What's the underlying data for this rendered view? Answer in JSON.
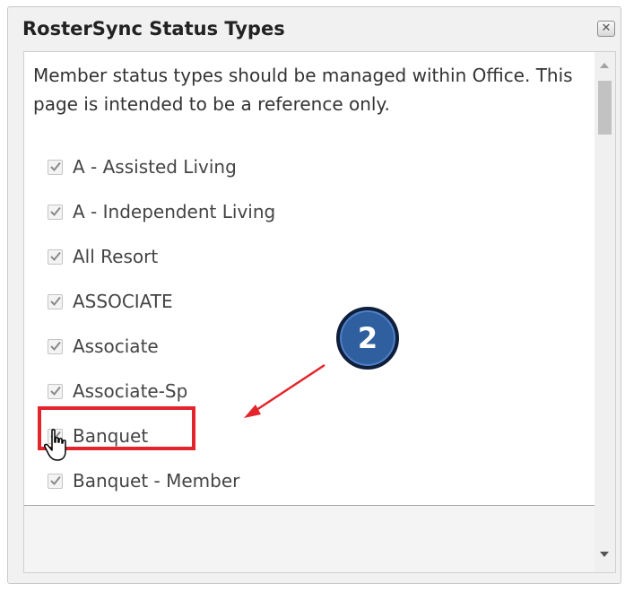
{
  "dialog": {
    "title": "RosterSync Status Types",
    "close_icon": "close-icon"
  },
  "intro_text": "Member status types should be managed within Office. This page is intended to be a reference only.",
  "status_types": [
    {
      "label": "A - Assisted Living",
      "checked": true
    },
    {
      "label": "A - Independent Living",
      "checked": true
    },
    {
      "label": "All Resort",
      "checked": true
    },
    {
      "label": "ASSOCIATE",
      "checked": true
    },
    {
      "label": "Associate",
      "checked": true
    },
    {
      "label": "Associate-Sp",
      "checked": true
    },
    {
      "label": "Banquet",
      "checked": true
    },
    {
      "label": "Banquet - Member",
      "checked": true
    }
  ],
  "annotation": {
    "step_number": "2",
    "highlight_color": "#e3242b",
    "badge_color": "#2f5f9f"
  }
}
